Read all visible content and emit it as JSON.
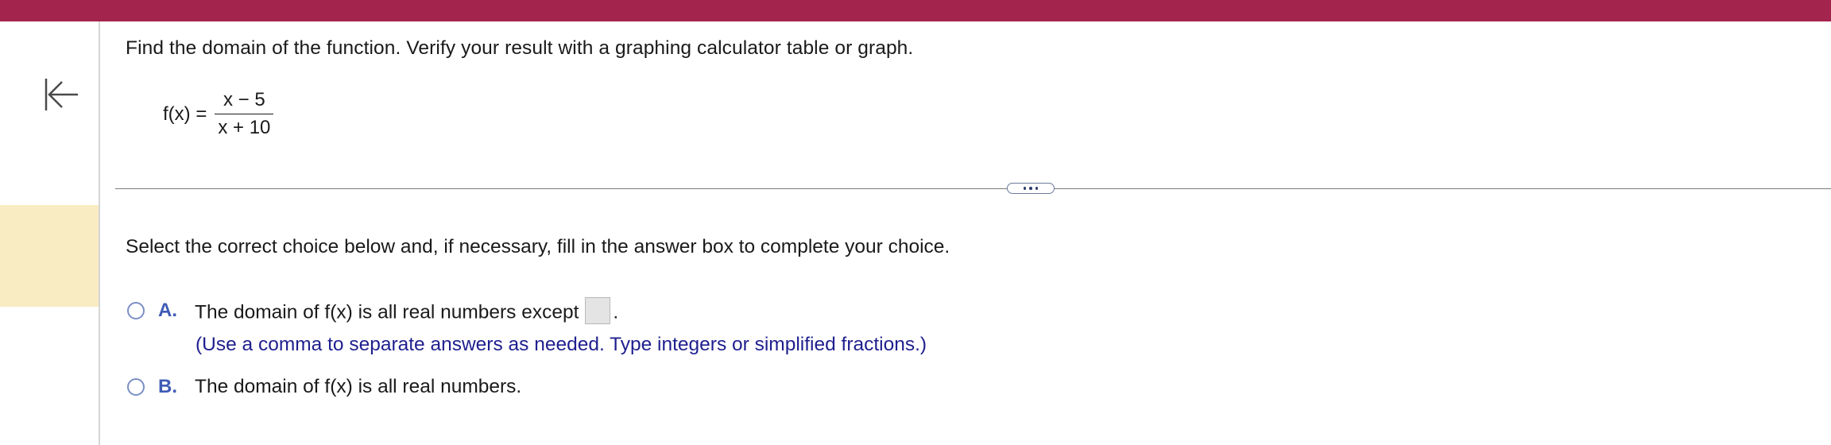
{
  "header": {
    "bar_color": "#a3244d"
  },
  "sidebar": {
    "collapse_icon": "arrow-left-to-bar-icon"
  },
  "question": {
    "prompt": "Find the domain of the function. Verify your result with a graphing calculator table or graph.",
    "function_name": "f(x) =",
    "numerator": "x − 5",
    "denominator": "x + 10"
  },
  "divider": {
    "more_icon": "ellipsis-icon"
  },
  "instruction": "Select the correct choice below and, if necessary, fill in the answer box to complete your choice.",
  "choices": [
    {
      "letter": "A.",
      "text": "The domain of f(x) is all real numbers except",
      "suffix": ".",
      "answer_value": "",
      "hint": "(Use a comma to separate answers as needed. Type integers or simplified fractions.)"
    },
    {
      "letter": "B.",
      "text": "The domain of f(x) is all real numbers."
    }
  ]
}
